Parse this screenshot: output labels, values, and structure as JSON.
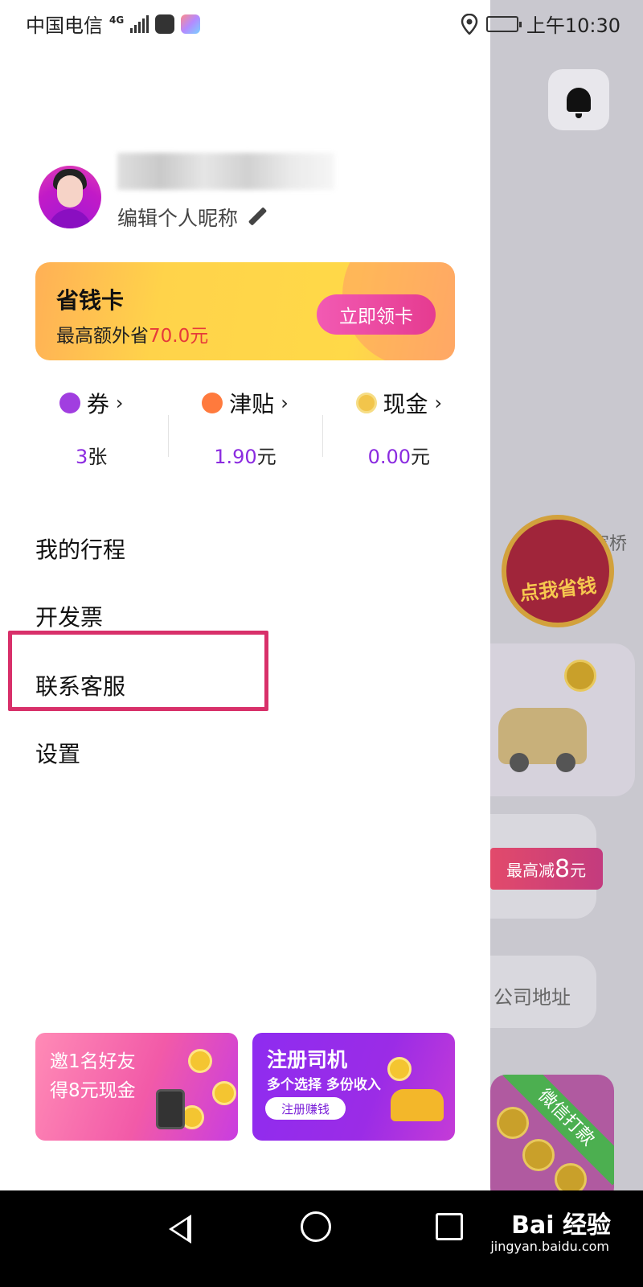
{
  "status_bar": {
    "carrier": "中国电信",
    "network": "4G",
    "time": "上午10:30"
  },
  "background": {
    "promo_text": "点我省钱",
    "location_fragment": "家桥",
    "coupon_prefix": "最高减",
    "coupon_amount": "8",
    "coupon_unit": "元",
    "address_placeholder": "公司地址",
    "wechat_ribbon": "微信打款"
  },
  "profile": {
    "edit_nickname_label": "编辑个人昵称"
  },
  "saving_card": {
    "title": "省钱卡",
    "subtitle_prefix": "最高额外省",
    "subtitle_amount": "70.0元",
    "claim_button": "立即领卡"
  },
  "assets": [
    {
      "label": "券",
      "value": "3",
      "unit": "张",
      "icon": "coupon-icon"
    },
    {
      "label": "津贴",
      "value": "1.90",
      "unit": "元",
      "icon": "allowance-icon"
    },
    {
      "label": "现金",
      "value": "0.00",
      "unit": "元",
      "icon": "cash-coin-icon"
    }
  ],
  "menu": [
    {
      "label": "我的行程"
    },
    {
      "label": "开发票"
    },
    {
      "label": "联系客服"
    },
    {
      "label": "设置"
    }
  ],
  "banners": {
    "invite": {
      "line1": "邀1名好友",
      "line2": "得8元现金"
    },
    "driver": {
      "line1": "注册司机",
      "line2": "多个选择 多份收入",
      "button": "注册赚钱"
    }
  },
  "watermark": {
    "brand": "Bai 经验",
    "url": "jingyan.baidu.com"
  },
  "colors": {
    "accent_purple": "#8b2be0",
    "highlight_border": "#d8306a",
    "saving_amount_red": "#e63a3a"
  }
}
